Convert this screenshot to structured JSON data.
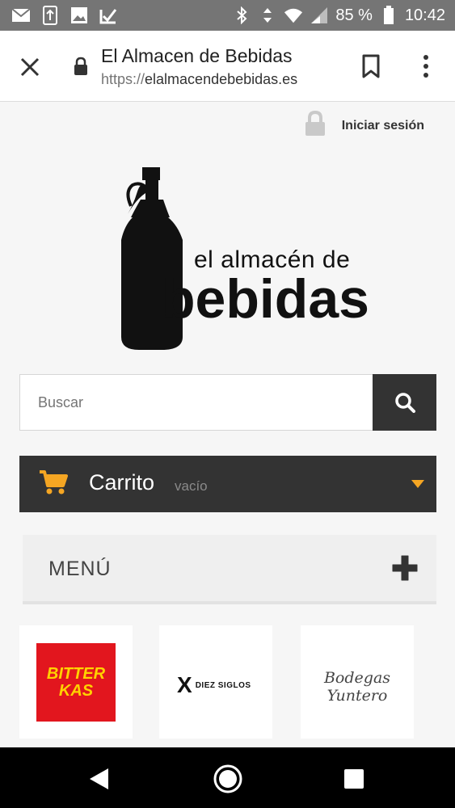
{
  "status_bar": {
    "battery_percent": "85 %",
    "time": "10:42",
    "left_icons": [
      "mail-icon",
      "download-icon",
      "image-icon",
      "check-icon"
    ],
    "right_icons": [
      "bluetooth-icon",
      "data-arrows-icon",
      "wifi-icon",
      "signal-icon",
      "battery-icon"
    ]
  },
  "browser": {
    "title": "El Almacen de Bebidas",
    "url_scheme": "https://",
    "url_host": "elalmacendebebidas.es"
  },
  "page": {
    "login_label": "Iniciar sesión",
    "logo": {
      "line1": "el almacén de",
      "line2": "bebidas"
    },
    "search": {
      "placeholder": "Buscar"
    },
    "cart": {
      "title": "Carrito",
      "status": "vacío"
    },
    "menu": {
      "title": "MENÚ"
    },
    "brands": [
      {
        "name_line1": "BITTER",
        "name_line2": "KAS"
      },
      {
        "mark": "X",
        "name": "DIEZ SIGLOS"
      },
      {
        "name": "Bodegas Yuntero"
      }
    ]
  },
  "colors": {
    "accent": "#f5a623",
    "dark": "#333333",
    "status_bar": "#757575"
  }
}
